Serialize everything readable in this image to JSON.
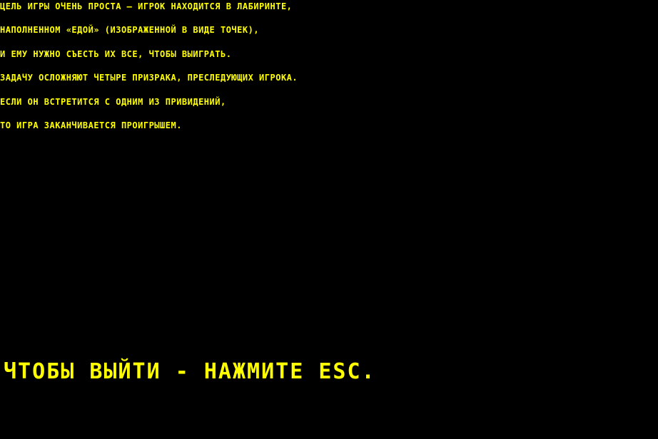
{
  "colors": {
    "background": "#000000",
    "text": "#FFFF00"
  },
  "rules": {
    "lines": [
      "цель игры очень проста – игрок находится в лабиринте,",
      "наполненном «едой» (изображенной в виде точек),",
      "и ему нужно съесть их все, чтобы выиграть.",
      "задачу осложняют четыре призрака, преследующих игрока.",
      "если он встретится с одним из привидений,",
      "то игра заканчивается проигрышем."
    ]
  },
  "exit_hint": "чтобы выйти - нажмите esc."
}
